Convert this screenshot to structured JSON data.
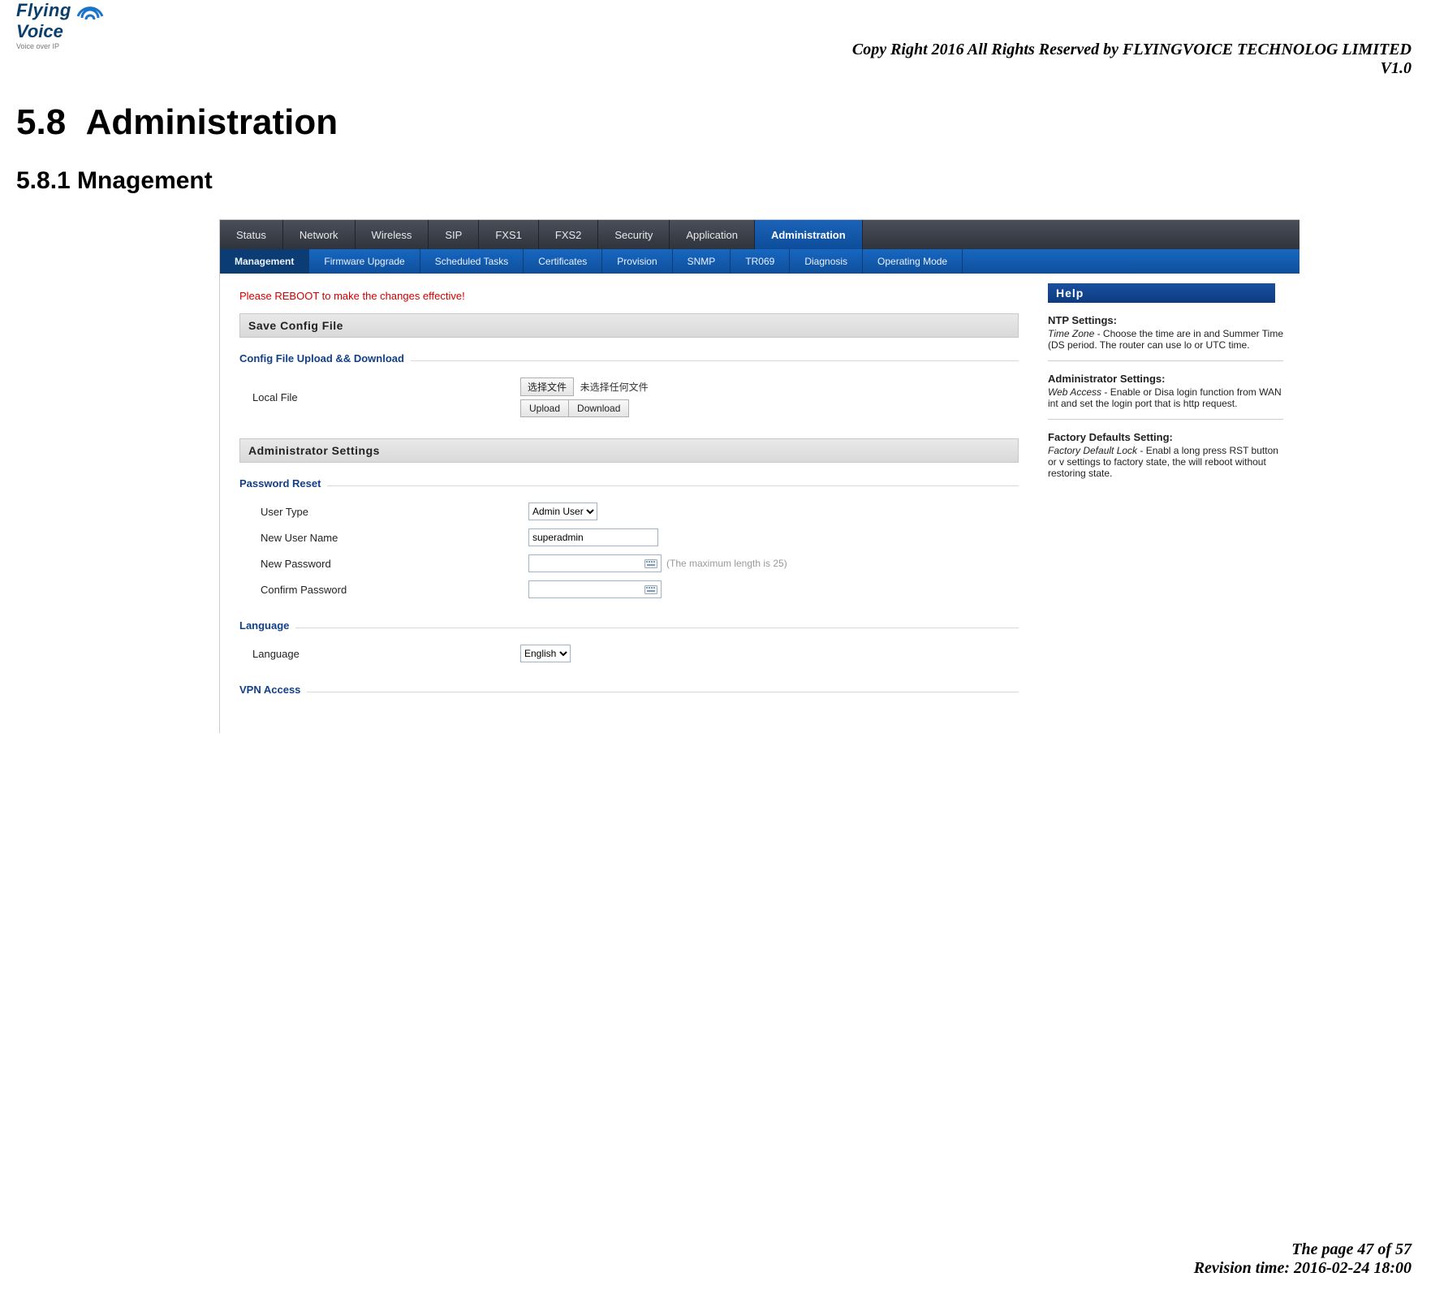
{
  "header": {
    "logo_line1": "Flying",
    "logo_line2": "Voice",
    "logo_tag": "Voice over IP",
    "copyright": "Copy Right 2016 All Rights Reserved by FLYINGVOICE TECHNOLOG LIMITED",
    "version": "V1.0"
  },
  "doc": {
    "section_no": "5.8",
    "section_title": "Administration",
    "subsection": "5.8.1 Mnagement"
  },
  "tabs_top": {
    "items": [
      "Status",
      "Network",
      "Wireless",
      "SIP",
      "FXS1",
      "FXS2",
      "Security",
      "Application",
      "Administration"
    ],
    "active_index": 8
  },
  "tabs_sub": {
    "items": [
      "Management",
      "Firmware Upgrade",
      "Scheduled Tasks",
      "Certificates",
      "Provision",
      "SNMP",
      "TR069",
      "Diagnosis",
      "Operating Mode"
    ],
    "active_index": 0
  },
  "notice": "Please REBOOT to make the changes effective!",
  "bars": {
    "save_config": "Save Config File",
    "admin_settings": "Administrator Settings"
  },
  "config_file": {
    "legend": "Config File Upload && Download",
    "local_file_label": "Local File",
    "choose_btn": "选择文件",
    "no_file": "未选择任何文件",
    "upload_btn": "Upload",
    "download_btn": "Download"
  },
  "password_reset": {
    "legend": "Password Reset",
    "user_type_label": "User Type",
    "user_type_value": "Admin User",
    "new_user_name_label": "New User Name",
    "new_user_name_value": "superadmin",
    "new_password_label": "New Password",
    "confirm_password_label": "Confirm Password",
    "max_hint": "(The maximum length is 25)"
  },
  "language": {
    "legend": "Language",
    "label": "Language",
    "value": "English"
  },
  "vpn": {
    "legend": "VPN Access"
  },
  "help": {
    "title": "Help",
    "ntp_title": "NTP Settings:",
    "ntp_body_lead": "Time Zone",
    "ntp_body_rest": " - Choose the time are in and Summer Time (DS period. The router can use lo or UTC time.",
    "admin_title": "Administrator Settings:",
    "admin_body_lead": "Web Access",
    "admin_body_rest": " - Enable or Disa login function from WAN int and set the login port that is http request.",
    "factory_title": "Factory Defaults Setting:",
    "factory_body_lead": "Factory Default Lock",
    "factory_body_rest": " - Enabl a long press RST button or v settings to factory state, the will reboot without restoring state."
  },
  "footer": {
    "page": "The page 47 of 57",
    "revision": "Revision time: 2016-02-24 18:00"
  }
}
